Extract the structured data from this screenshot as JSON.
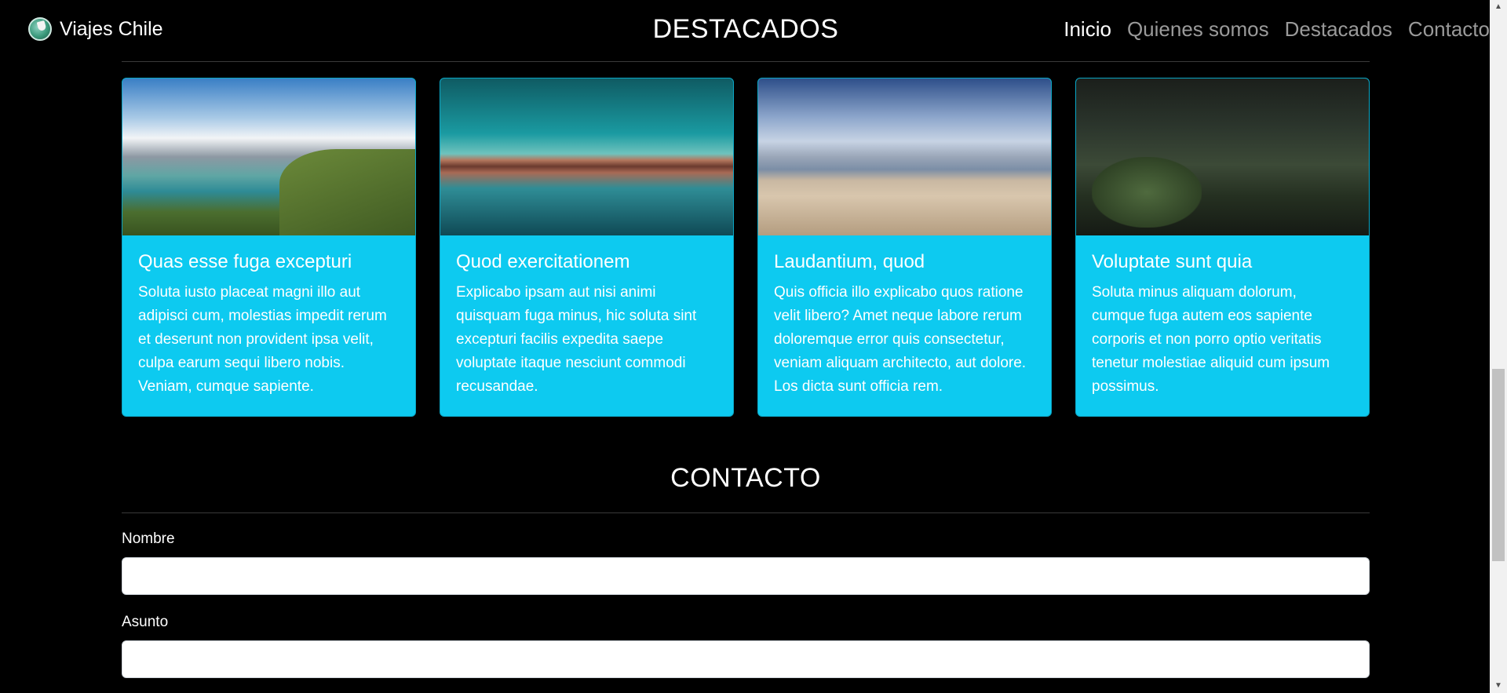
{
  "navbar": {
    "brand": "Viajes Chile",
    "links": [
      {
        "label": "Inicio",
        "active": true
      },
      {
        "label": "Quienes somos",
        "active": false
      },
      {
        "label": "Destacados",
        "active": false
      },
      {
        "label": "Contacto",
        "active": false
      }
    ]
  },
  "destacados": {
    "title": "DESTACADOS",
    "cards": [
      {
        "title": "Quas esse fuga excepturi",
        "text": "Soluta iusto placeat magni illo aut adipisci cum, molestias impedit rerum et deserunt non provident ipsa velit, culpa earum sequi libero nobis. Veniam, cumque sapiente."
      },
      {
        "title": "Quod exercitationem",
        "text": "Explicabo ipsam aut nisi animi quisquam fuga minus, hic soluta sint excepturi facilis expedita saepe voluptate itaque nesciunt commodi recusandae."
      },
      {
        "title": "Laudantium, quod",
        "text": "Quis officia illo explicabo quos ratione velit libero? Amet neque labore rerum doloremque error quis consectetur, veniam aliquam architecto, aut dolore. Los dicta sunt officia rem."
      },
      {
        "title": "Voluptate sunt quia",
        "text": "Soluta minus aliquam dolorum, cumque fuga autem eos sapiente corporis et non porro optio veritatis tenetur molestiae aliquid cum ipsum possimus."
      }
    ]
  },
  "contacto": {
    "title": "CONTACTO",
    "fields": [
      {
        "label": "Nombre",
        "value": ""
      },
      {
        "label": "Asunto",
        "value": ""
      }
    ]
  },
  "colors": {
    "card_bg": "#0dcaf0",
    "page_bg": "#000000",
    "nav_inactive": "#9a9a9a"
  }
}
